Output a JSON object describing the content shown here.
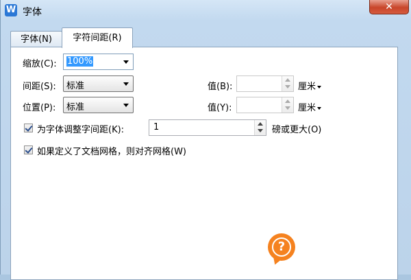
{
  "window": {
    "title": "字体",
    "close_symbol": "✕",
    "app_icon_letter": "W"
  },
  "tabs": [
    {
      "label": "字体(N)",
      "active": false
    },
    {
      "label": "字符间距(R)",
      "active": true
    }
  ],
  "scale": {
    "label": "缩放(C):",
    "value": "100%"
  },
  "spacing": {
    "label": "间距(S):",
    "value": "标准",
    "amount_label": "值(B):",
    "amount_value": "",
    "unit": "厘米"
  },
  "position": {
    "label": "位置(P):",
    "value": "标准",
    "amount_label": "值(Y):",
    "amount_value": "",
    "unit": "厘米"
  },
  "kerning": {
    "label": "为字体调整字间距(K):",
    "checked": true,
    "value": "1",
    "suffix": "磅或更大(O)"
  },
  "grid_snap": {
    "label": "如果定义了文档网格，则对齐网格(W)",
    "checked": true
  },
  "help": {
    "symbol": "?"
  },
  "colors": {
    "help": "#f5821f",
    "selection": "#3399ff",
    "close": "#c8452a"
  }
}
